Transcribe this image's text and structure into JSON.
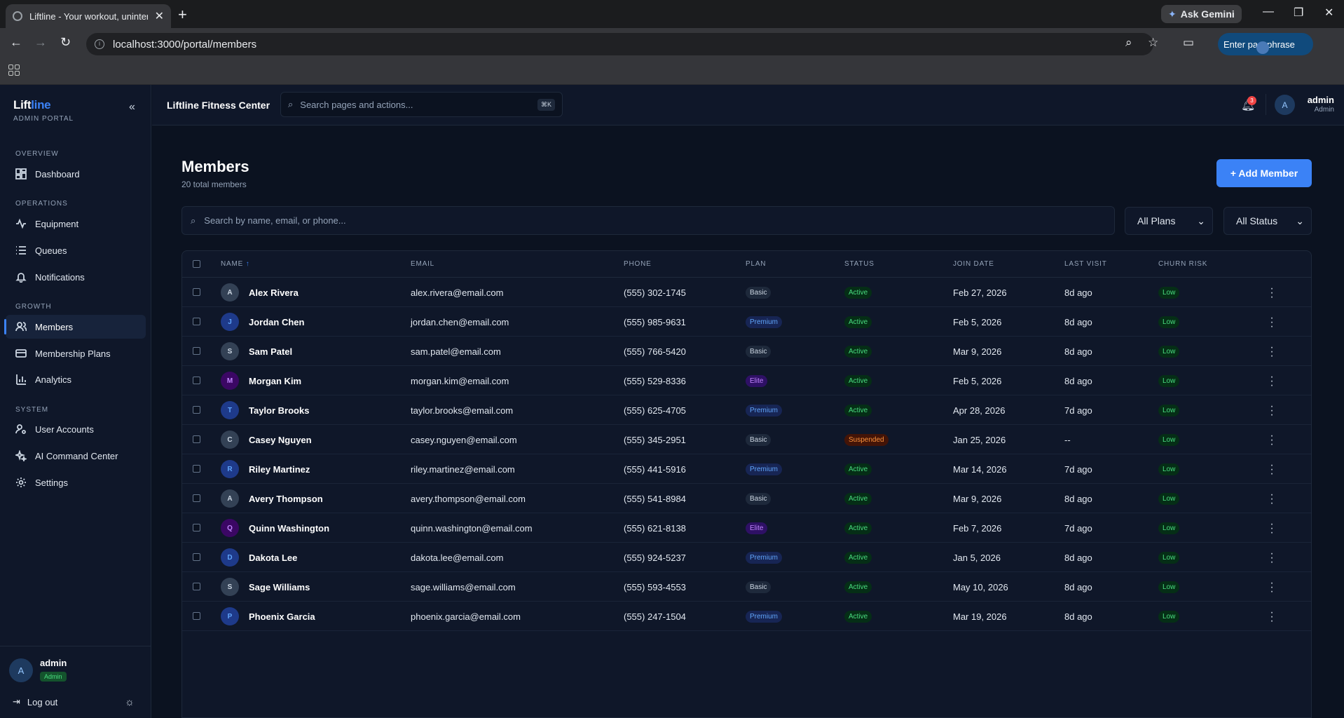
{
  "browser": {
    "tab_title": "Liftline - Your workout, uninterr",
    "url": "localhost:3000/portal/members",
    "ask_gemini": "Ask Gemini",
    "passphrase": "Enter passphrase"
  },
  "sidebar": {
    "logo_a": "Lift",
    "logo_b": "line",
    "logo_sub": "ADMIN PORTAL",
    "sections": {
      "overview": "OVERVIEW",
      "operations": "OPERATIONS",
      "growth": "GROWTH",
      "system": "SYSTEM"
    },
    "items": {
      "dashboard": "Dashboard",
      "equipment": "Equipment",
      "queues": "Queues",
      "notifications": "Notifications",
      "members": "Members",
      "plans": "Membership Plans",
      "analytics": "Analytics",
      "users": "User Accounts",
      "ai": "AI Command Center",
      "settings": "Settings"
    },
    "user": {
      "initial": "A",
      "name": "admin",
      "role": "Admin"
    },
    "logout": "Log out"
  },
  "topbar": {
    "org": "Liftline Fitness Center",
    "search_placeholder": "Search pages and actions...",
    "shortcut": "⌘K",
    "notif_count": "3",
    "user_initial": "A",
    "user_name": "admin",
    "user_role": "Admin"
  },
  "page": {
    "title": "Members",
    "subtitle": "20 total members",
    "add_button": "+ Add Member",
    "search_placeholder": "Search by name, email, or phone...",
    "plan_filter": "All Plans",
    "status_filter": "All Status"
  },
  "table": {
    "headers": {
      "name": "NAME",
      "name_sort": "↑",
      "email": "EMAIL",
      "phone": "PHONE",
      "plan": "PLAN",
      "status": "STATUS",
      "join": "JOIN DATE",
      "last": "LAST VISIT",
      "churn": "CHURN RISK"
    },
    "rows": [
      {
        "initial": "A",
        "name": "Alex Rivera",
        "email": "alex.rivera@email.com",
        "phone": "(555) 302-1745",
        "plan": "Basic",
        "status": "Active",
        "join": "Feb 27, 2026",
        "last": "8d ago",
        "churn": "Low"
      },
      {
        "initial": "J",
        "name": "Jordan Chen",
        "email": "jordan.chen@email.com",
        "phone": "(555) 985-9631",
        "plan": "Premium",
        "status": "Active",
        "join": "Feb 5, 2026",
        "last": "8d ago",
        "churn": "Low"
      },
      {
        "initial": "S",
        "name": "Sam Patel",
        "email": "sam.patel@email.com",
        "phone": "(555) 766-5420",
        "plan": "Basic",
        "status": "Active",
        "join": "Mar 9, 2026",
        "last": "8d ago",
        "churn": "Low"
      },
      {
        "initial": "M",
        "name": "Morgan Kim",
        "email": "morgan.kim@email.com",
        "phone": "(555) 529-8336",
        "plan": "Elite",
        "status": "Active",
        "join": "Feb 5, 2026",
        "last": "8d ago",
        "churn": "Low"
      },
      {
        "initial": "T",
        "name": "Taylor Brooks",
        "email": "taylor.brooks@email.com",
        "phone": "(555) 625-4705",
        "plan": "Premium",
        "status": "Active",
        "join": "Apr 28, 2026",
        "last": "7d ago",
        "churn": "Low"
      },
      {
        "initial": "C",
        "name": "Casey Nguyen",
        "email": "casey.nguyen@email.com",
        "phone": "(555) 345-2951",
        "plan": "Basic",
        "status": "Suspended",
        "join": "Jan 25, 2026",
        "last": "--",
        "churn": "Low"
      },
      {
        "initial": "R",
        "name": "Riley Martinez",
        "email": "riley.martinez@email.com",
        "phone": "(555) 441-5916",
        "plan": "Premium",
        "status": "Active",
        "join": "Mar 14, 2026",
        "last": "7d ago",
        "churn": "Low"
      },
      {
        "initial": "A",
        "name": "Avery Thompson",
        "email": "avery.thompson@email.com",
        "phone": "(555) 541-8984",
        "plan": "Basic",
        "status": "Active",
        "join": "Mar 9, 2026",
        "last": "8d ago",
        "churn": "Low"
      },
      {
        "initial": "Q",
        "name": "Quinn Washington",
        "email": "quinn.washington@email.com",
        "phone": "(555) 621-8138",
        "plan": "Elite",
        "status": "Active",
        "join": "Feb 7, 2026",
        "last": "7d ago",
        "churn": "Low"
      },
      {
        "initial": "D",
        "name": "Dakota Lee",
        "email": "dakota.lee@email.com",
        "phone": "(555) 924-5237",
        "plan": "Premium",
        "status": "Active",
        "join": "Jan 5, 2026",
        "last": "8d ago",
        "churn": "Low"
      },
      {
        "initial": "S",
        "name": "Sage Williams",
        "email": "sage.williams@email.com",
        "phone": "(555) 593-4553",
        "plan": "Basic",
        "status": "Active",
        "join": "May 10, 2026",
        "last": "8d ago",
        "churn": "Low"
      },
      {
        "initial": "P",
        "name": "Phoenix Garcia",
        "email": "phoenix.garcia@email.com",
        "phone": "(555) 247-1504",
        "plan": "Premium",
        "status": "Active",
        "join": "Mar 19, 2026",
        "last": "8d ago",
        "churn": "Low"
      }
    ]
  },
  "colors": {
    "accent": "#3b82f6",
    "basic_bg": "#1e293b",
    "basic_fg": "#cbd5e1",
    "premium_bg": "#172554",
    "premium_fg": "#60a5fa",
    "elite_bg": "#2e1065",
    "elite_fg": "#c084fc",
    "active_bg": "#052e16",
    "active_fg": "#4ade80",
    "suspended_bg": "#431407",
    "suspended_fg": "#fb923c"
  }
}
